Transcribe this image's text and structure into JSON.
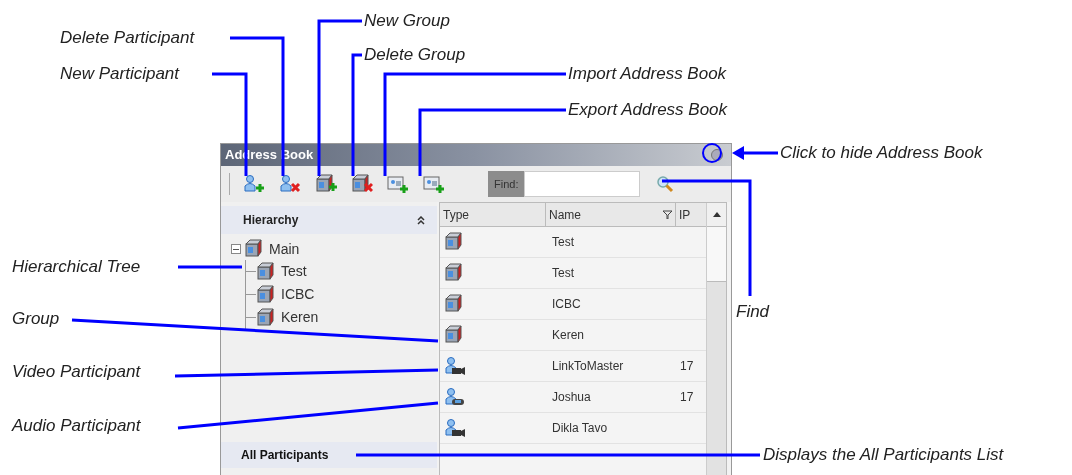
{
  "callouts": [
    {
      "label": "Delete Participant"
    },
    {
      "label": "New Participant"
    },
    {
      "label": "New Group"
    },
    {
      "label": "Delete Group"
    },
    {
      "label": "Import Address Book"
    },
    {
      "label": "Export Address Book"
    },
    {
      "label": "Click to hide Address Book"
    },
    {
      "label": "Find"
    },
    {
      "label": "Hierarchical Tree"
    },
    {
      "label": "Group"
    },
    {
      "label": "Video Participant"
    },
    {
      "label": "Audio Participant"
    },
    {
      "label": "Displays the All Participants List"
    }
  ],
  "window": {
    "title": "Address Book"
  },
  "toolbar": {
    "buttons": [
      {
        "kind": "new-participant"
      },
      {
        "kind": "delete-participant"
      },
      {
        "kind": "new-group"
      },
      {
        "kind": "delete-group"
      },
      {
        "kind": "import"
      },
      {
        "kind": "export"
      }
    ],
    "find_label": "Find:"
  },
  "hierarchy": {
    "title": "Hierarchy",
    "tree": [
      {
        "label": "Main",
        "expanded": true,
        "children": [
          {
            "label": "Test"
          },
          {
            "label": "ICBC"
          },
          {
            "label": "Keren"
          }
        ]
      }
    ]
  },
  "table": {
    "columns": [
      "Type",
      "Name",
      "IP"
    ],
    "rows": [
      {
        "kind": "group",
        "name": "Test"
      },
      {
        "kind": "group",
        "name": "Test"
      },
      {
        "kind": "group",
        "name": "ICBC"
      },
      {
        "kind": "group",
        "name": "Keren"
      },
      {
        "kind": "video",
        "name": "LinkToMaster",
        "column_3": "17"
      },
      {
        "kind": "audio",
        "name": "Joshua",
        "column_3": "17"
      },
      {
        "kind": "video",
        "name": "Dikla Tavo"
      }
    ]
  },
  "footer": {
    "label": "All Participants"
  }
}
